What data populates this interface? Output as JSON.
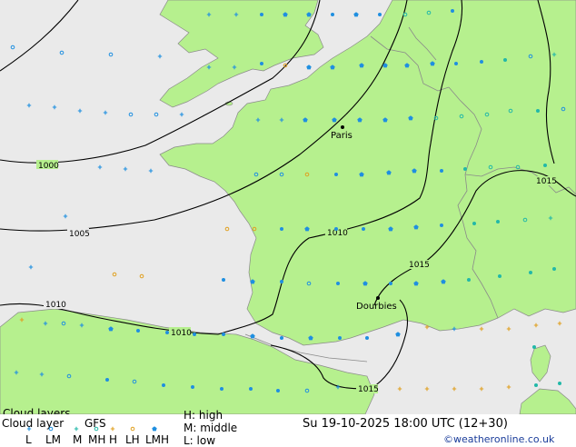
{
  "legend": {
    "title": "Cloud layers",
    "subtitle": "Cloud layer",
    "model": "GFS",
    "codes": [
      "L",
      "LM",
      "M",
      "MH",
      "H",
      "LH",
      "LMH"
    ],
    "high": "H: high",
    "middle": "M: middle",
    "low": "L: low"
  },
  "footer": {
    "datetime": "Su 19-10-2025 18:00 UTC (12+30)",
    "credit": "©weatheronline.co.uk"
  },
  "map": {
    "cities": [
      {
        "name": "Paris"
      },
      {
        "name": "Dourbies"
      }
    ],
    "isobar_labels": [
      "1000",
      "1005",
      "1010",
      "1010",
      "1010",
      "1015",
      "1015",
      "1015"
    ],
    "colors": {
      "land": "#b6f08e",
      "sea": "#eaeaea",
      "border": "#8a8a8a",
      "isobar": "#000000",
      "low": "#1f8fe0",
      "middle": "#22b8a8",
      "high": "#e0a020"
    }
  }
}
